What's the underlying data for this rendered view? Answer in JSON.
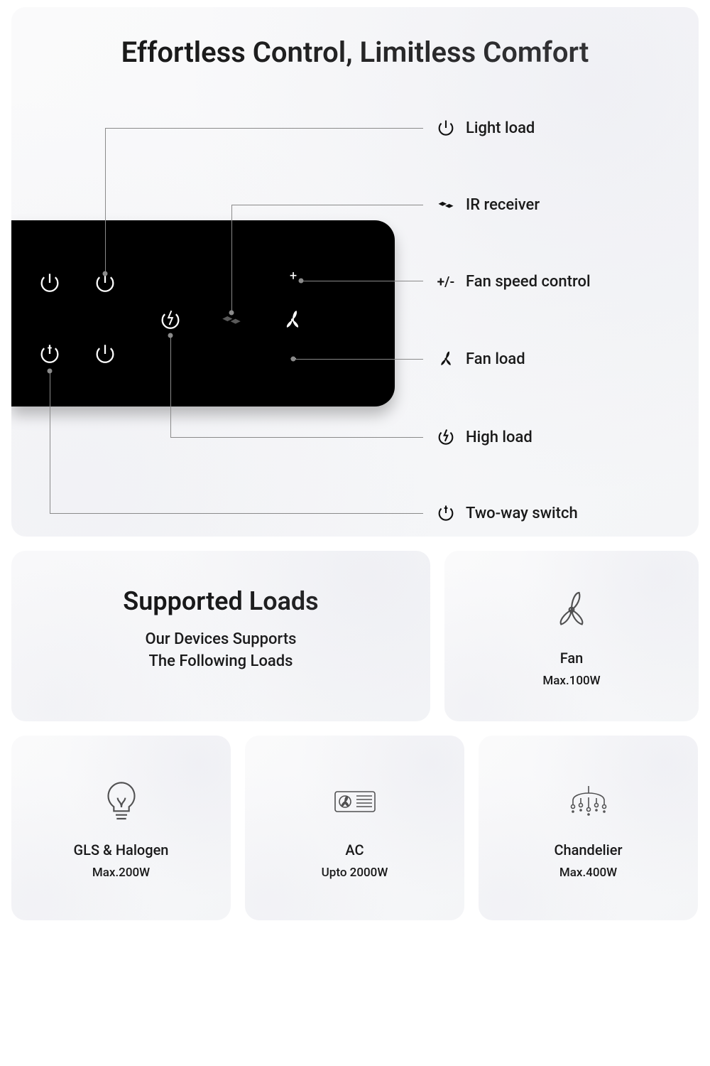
{
  "top": {
    "title": "Effortless Control, Limitless Comfort",
    "callouts": {
      "light": {
        "label": "Light load"
      },
      "ir": {
        "label": "IR receiver"
      },
      "speed": {
        "prefix": "+/-",
        "label": "Fan speed control"
      },
      "fan": {
        "label": "Fan load"
      },
      "high": {
        "label": "High load"
      },
      "twoway": {
        "label": "Two-way switch"
      }
    }
  },
  "supported": {
    "title": "Supported Loads",
    "subtitle_l1": "Our Devices Supports",
    "subtitle_l2": "The Following Loads",
    "items": {
      "fan": {
        "label": "Fan",
        "max": "Max.100W"
      },
      "gls": {
        "label": "GLS & Halogen",
        "max": "Max.200W"
      },
      "ac": {
        "label": "AC",
        "max": "Upto 2000W"
      },
      "chand": {
        "label": "Chandelier",
        "max": "Max.400W"
      }
    }
  }
}
